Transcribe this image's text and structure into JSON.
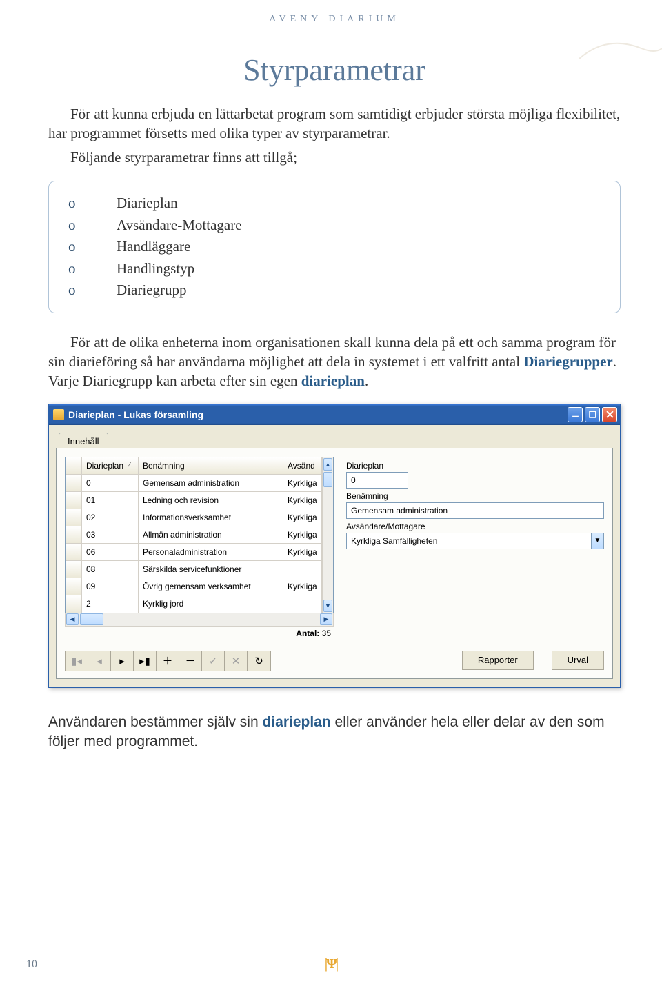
{
  "page": {
    "header": "AVENY DIARIUM",
    "title": "Styrparametrar",
    "intro1": "För att kunna erbjuda en lättarbetat program som samtidigt erbjuder största möjliga flexibilitet, har programmet försetts med olika typer av styrparametrar.",
    "intro2": "Följande styrparametrar finns att tillgå;",
    "bullets": {
      "0": "Diarieplan",
      "1": "Avsändare-Mottagare",
      "2": "Handläggare",
      "3": "Handlingstyp",
      "4": "Diariegrupp"
    },
    "bullet_marker": "o",
    "para2_a": "För att de olika enheterna inom organisationen skall kunna dela på ett och samma program för sin diarieföring så har användarna möjlighet att dela in systemet i ett valfritt antal ",
    "para2_b": "Diariegrupper",
    "para2_c": ". Varje Diariegrupp kan arbeta efter sin egen ",
    "para2_d": "diarieplan",
    "para2_e": ".",
    "footer_a": "Användaren bestämmer själv sin ",
    "footer_b": "diarieplan",
    "footer_c": " eller använder hela eller delar av den som följer med programmet.",
    "number": "10"
  },
  "window": {
    "title": "Diarieplan - Lukas församling",
    "tab": "Innehåll",
    "headers": {
      "dp": "Diarieplan",
      "bn": "Benämning",
      "av": "Avsänd"
    },
    "rows": {
      "0": {
        "dp": "0",
        "bn": "Gemensam administration",
        "av": "Kyrkliga"
      },
      "1": {
        "dp": "01",
        "bn": "Ledning och revision",
        "av": "Kyrkliga"
      },
      "2": {
        "dp": "02",
        "bn": "Informationsverksamhet",
        "av": "Kyrkliga"
      },
      "3": {
        "dp": "03",
        "bn": "Allmän administration",
        "av": "Kyrkliga"
      },
      "4": {
        "dp": "06",
        "bn": "Personaladministration",
        "av": "Kyrkliga"
      },
      "5": {
        "dp": "08",
        "bn": "Särskilda servicefunktioner",
        "av": ""
      },
      "6": {
        "dp": "09",
        "bn": "Övrig gemensam verksamhet",
        "av": "Kyrkliga"
      },
      "7": {
        "dp": "2",
        "bn": "Kyrklig jord",
        "av": ""
      }
    },
    "antal_label": "Antal:",
    "antal_value": "35",
    "detail": {
      "dp_label": "Diarieplan",
      "dp_value": "0",
      "bn_label": "Benämning",
      "bn_value": "Gemensam administration",
      "am_label": "Avsändare/Mottagare",
      "am_value": "Kyrkliga Samfälligheten"
    },
    "buttons": {
      "rapporter_pre": "R",
      "rapporter_rest": "apporter",
      "urval_pre": "Ur",
      "urval_u": "v",
      "urval_rest": "al"
    }
  }
}
